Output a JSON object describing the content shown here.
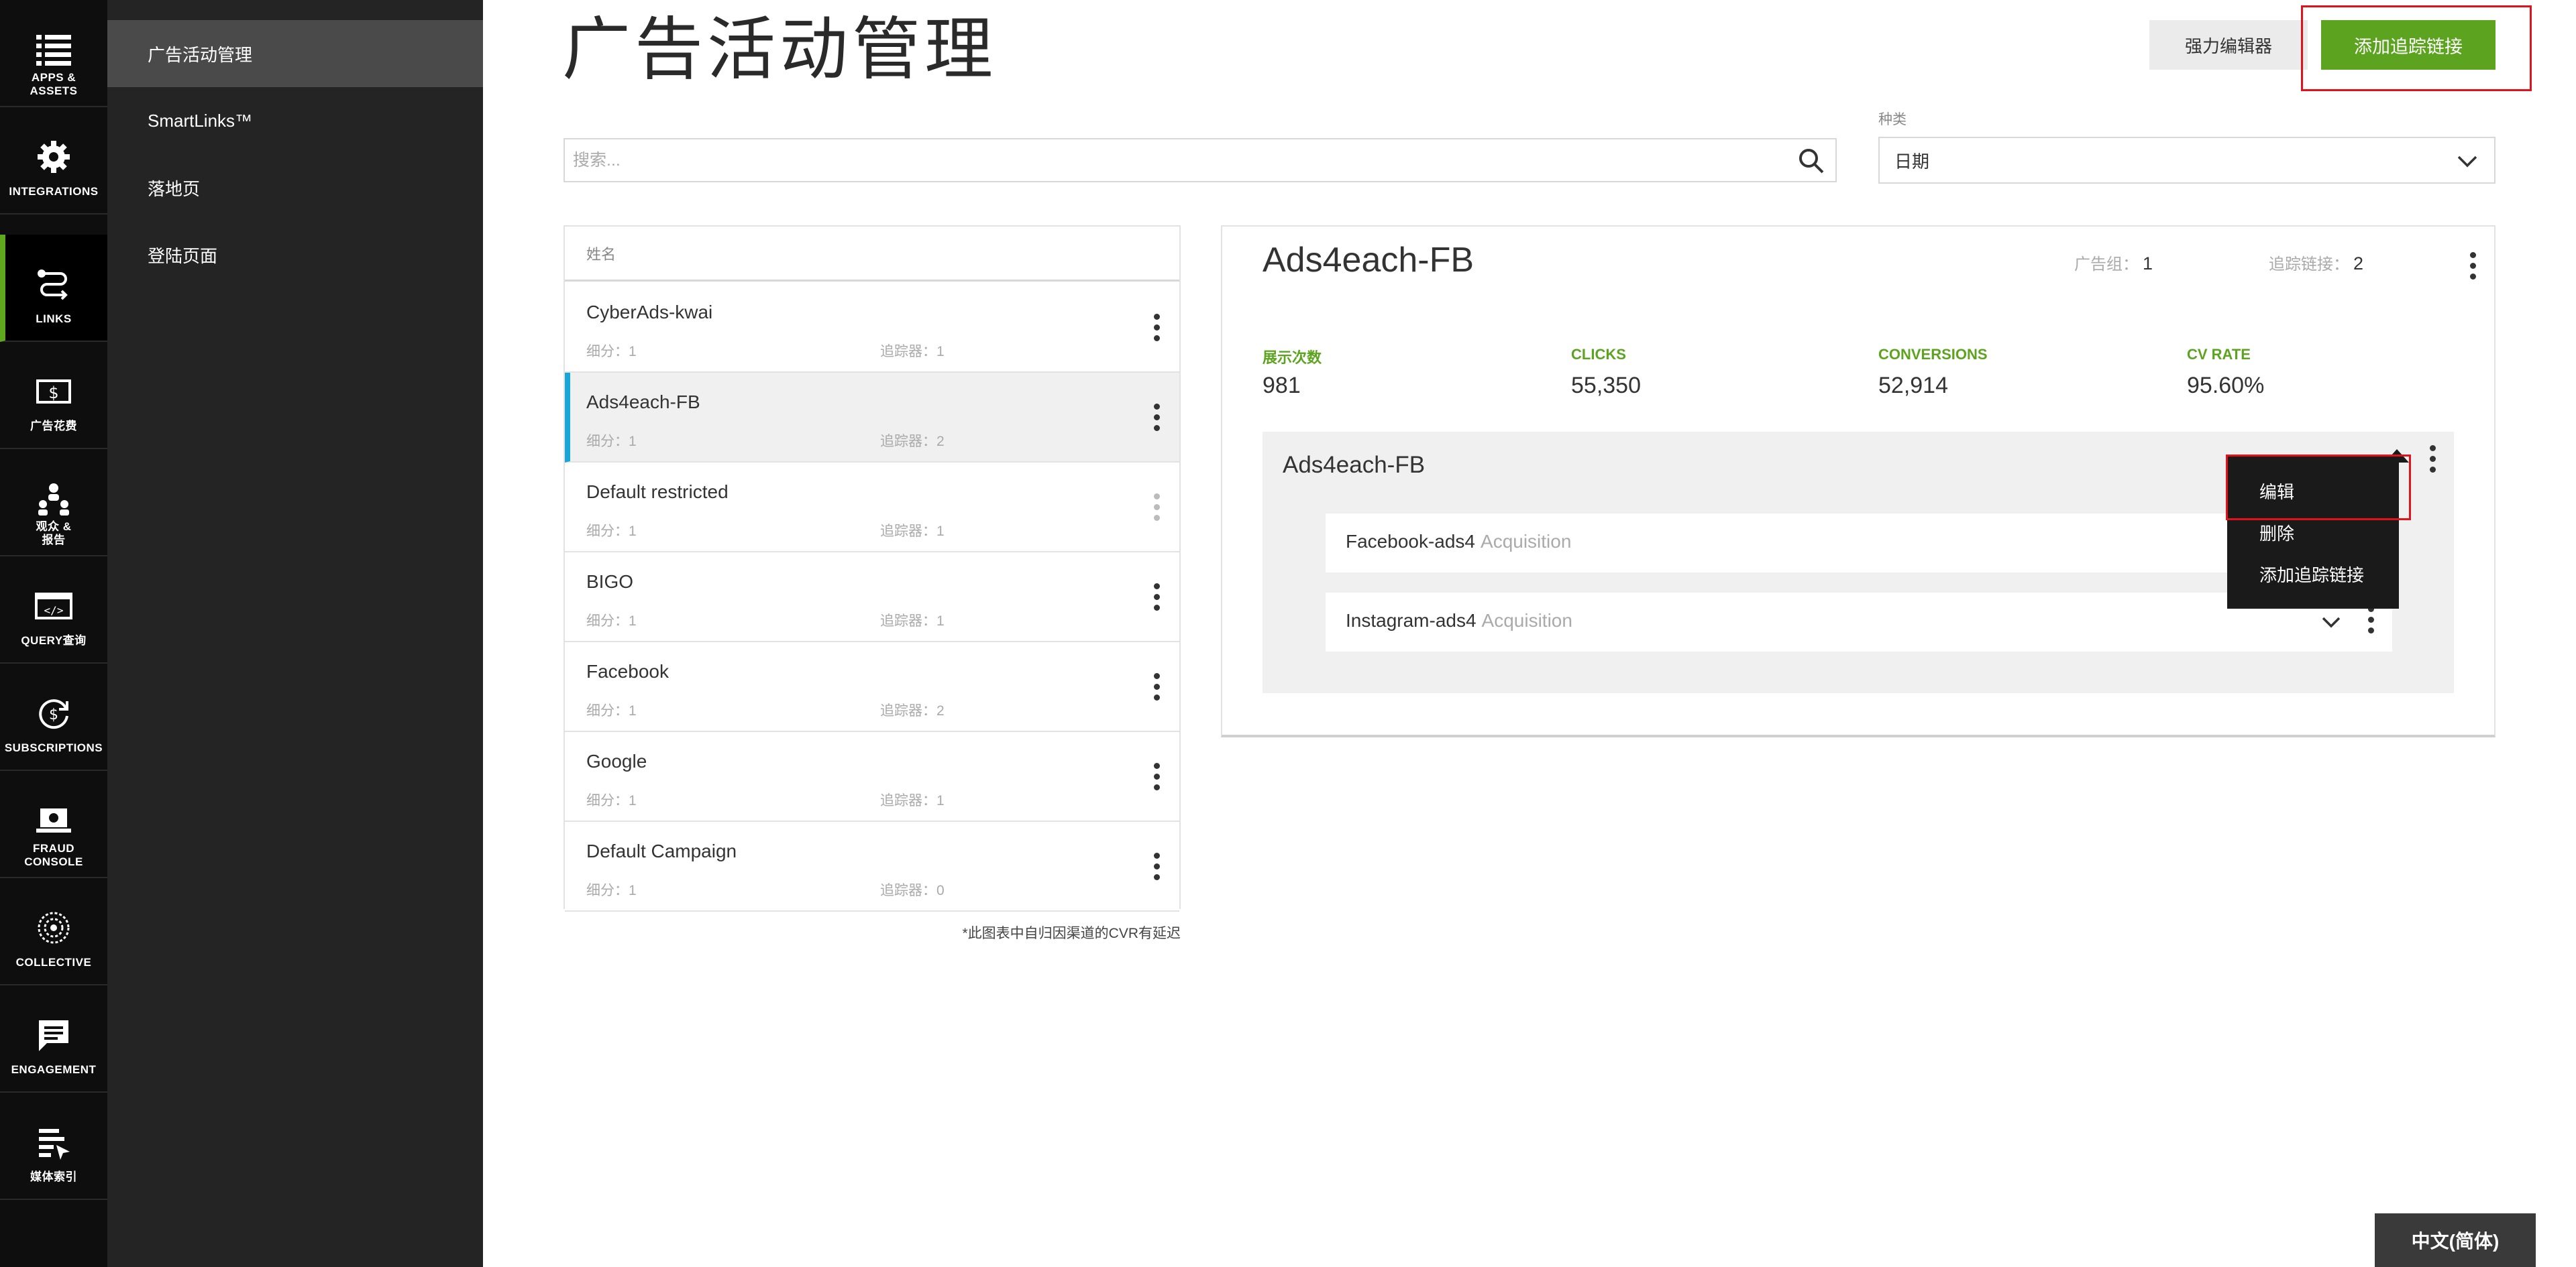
{
  "rail": {
    "items": [
      {
        "label": "APPS &\nASSETS",
        "icon": "apps-list-icon"
      },
      {
        "label": "INTEGRATIONS",
        "icon": "gear-icon"
      },
      {
        "label": "LINKS",
        "icon": "links-path-icon"
      },
      {
        "label": "广告花费",
        "icon": "dollar-bill-icon"
      },
      {
        "label": "观众 &\n报告",
        "icon": "audience-icon"
      },
      {
        "label": "QUERY查询",
        "icon": "code-window-icon"
      },
      {
        "label": "SUBSCRIPTIONS",
        "icon": "dollar-cycle-icon"
      },
      {
        "label": "FRAUD\nCONSOLE",
        "icon": "fraud-laptop-icon"
      },
      {
        "label": "COLLECTIVE",
        "icon": "collective-icon"
      },
      {
        "label": "ENGAGEMENT",
        "icon": "chat-icon"
      },
      {
        "label": "媒体索引",
        "icon": "media-index-icon"
      }
    ]
  },
  "subnav": {
    "items": [
      "广告活动管理",
      "SmartLinks™",
      "落地页",
      "登陆页面"
    ]
  },
  "header": {
    "title": "广告活动管理",
    "power_editor": "强力编辑器",
    "add_tracking_link": "添加追踪链接"
  },
  "search": {
    "placeholder": "搜索...",
    "value": ""
  },
  "type_filter": {
    "label": "种类",
    "value": "日期"
  },
  "list": {
    "header": "姓名",
    "rows": [
      {
        "name": "CyberAds-kwai",
        "seg_label": "细分：",
        "seg": "1",
        "trk_label": "追踪器：",
        "trk": "1"
      },
      {
        "name": "Ads4each-FB",
        "seg_label": "细分：",
        "seg": "1",
        "trk_label": "追踪器：",
        "trk": "2"
      },
      {
        "name": "Default restricted",
        "seg_label": "细分：",
        "seg": "1",
        "trk_label": "追踪器：",
        "trk": "1"
      },
      {
        "name": "BIGO",
        "seg_label": "细分：",
        "seg": "1",
        "trk_label": "追踪器：",
        "trk": "1"
      },
      {
        "name": "Facebook",
        "seg_label": "细分：",
        "seg": "1",
        "trk_label": "追踪器：",
        "trk": "2"
      },
      {
        "name": "Google",
        "seg_label": "细分：",
        "seg": "1",
        "trk_label": "追踪器：",
        "trk": "1"
      },
      {
        "name": "Default Campaign",
        "seg_label": "细分：",
        "seg": "1",
        "trk_label": "追踪器：",
        "trk": "0"
      }
    ],
    "footnote": "*此图表中自归因渠道的CVR有延迟"
  },
  "detail": {
    "title": "Ads4each-FB",
    "adgroups_label": "广告组：",
    "adgroups": "1",
    "links_label": "追踪链接：",
    "links": "2",
    "stats": [
      {
        "label": "展示次数",
        "value": "981"
      },
      {
        "label": "CLICKS",
        "value": "55,350"
      },
      {
        "label": "CONVERSIONS",
        "value": "52,914"
      },
      {
        "label": "CV RATE",
        "value": "95.60%"
      }
    ],
    "adgroup": {
      "name": "Ads4each-FB",
      "links": [
        {
          "name": "Facebook-ads4",
          "tag": "Acquisition"
        },
        {
          "name": "Instagram-ads4",
          "tag": "Acquisition"
        }
      ]
    }
  },
  "context_menu": {
    "items": [
      "编辑",
      "删除",
      "添加追踪链接"
    ]
  },
  "language": "中文(简体)",
  "colors": {
    "accent_green": "#5ca41f",
    "selected_bar": "#17a6d6",
    "highlight_red": "#e0121b"
  }
}
